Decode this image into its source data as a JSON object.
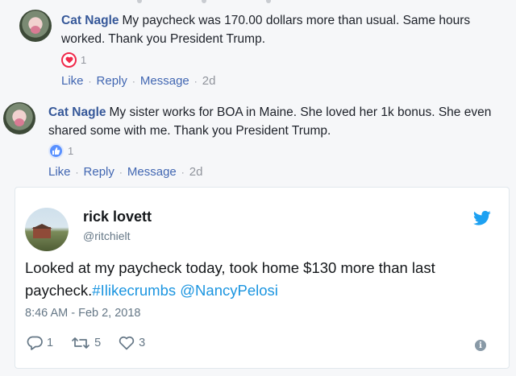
{
  "comments": [
    {
      "author": "Cat Nagle",
      "text": "My paycheck was 170.00 dollars more than usual. Same hours worked. Thank you President Trump.",
      "reaction_icon": "heart-icon",
      "reaction_count": "1",
      "actions": [
        "Like",
        "Reply",
        "Message"
      ],
      "time": "2d"
    },
    {
      "author": "Cat Nagle",
      "text": "My sister works for BOA in Maine. She loved her 1k bonus. She even shared some with me. Thank you President Trump.",
      "reaction_icon": "thumbs-up-icon",
      "reaction_count": "1",
      "actions": [
        "Like",
        "Reply",
        "Message"
      ],
      "time": "2d"
    }
  ],
  "tweet": {
    "name": "rick lovett",
    "handle": "@ritchielt",
    "text_plain": "Looked at my paycheck today, took home $130 more than last paycheck.",
    "hashtag": "#Ilikecrumbs",
    "mention": "@NancyPelosi",
    "timestamp": "8:46 AM - Feb 2, 2018",
    "reply_count": "1",
    "retweet_count": "5",
    "like_count": "3",
    "info_label": "i"
  },
  "colors": {
    "facebook_link": "#365899",
    "facebook_action": "#4267b2",
    "twitter_blue": "#1da1f2",
    "twitter_link": "#1b95e0",
    "love_red": "#f0284a",
    "like_blue": "#5890ff"
  }
}
